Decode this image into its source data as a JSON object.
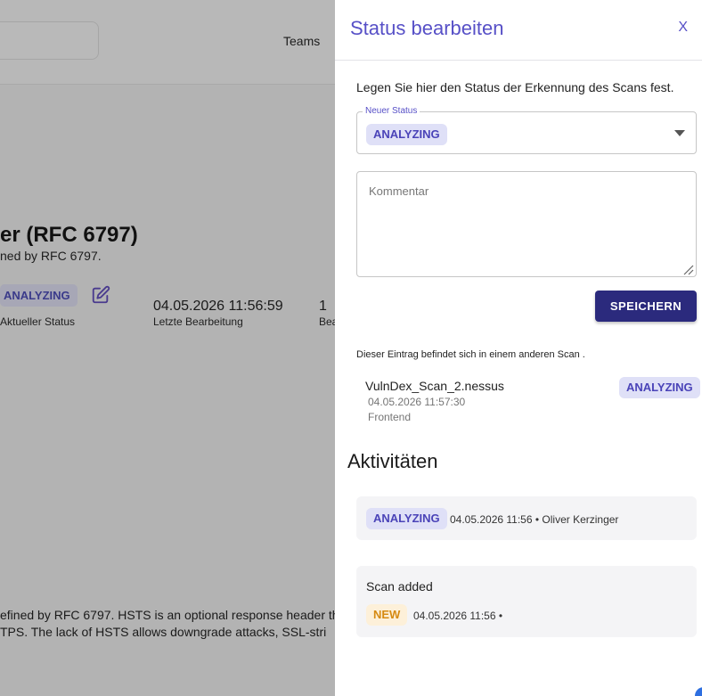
{
  "background": {
    "nav_teams": "Teams",
    "title": "er (RFC 6797)",
    "subtitle": "ned by RFC 6797.",
    "status_badge": "ANALYZING",
    "status_label": "Aktueller Status",
    "last_edit_value": "04.05.2026 11:56:59",
    "last_edit_label": "Letzte Bearbeitung",
    "count_value": "1",
    "count_label": "Bea",
    "description_line1": "efined by RFC 6797. HSTS is an optional response header th",
    "description_line2": "TPS. The lack of HSTS allows downgrade attacks, SSL-stri"
  },
  "drawer": {
    "title": "Status bearbeiten",
    "close_label": "X",
    "intro": "Legen Sie hier den Status der Erkennung des Scans fest.",
    "status_select": {
      "legend": "Neuer Status",
      "selected": "ANALYZING"
    },
    "comment_placeholder": "Kommentar",
    "save_label": "SPEICHERN",
    "note": "Dieser Eintrag befindet sich in einem anderen Scan .",
    "scan": {
      "name": "VulnDex_Scan_2.nessus",
      "date": "04.05.2026 11:57:30",
      "team": "Frontend",
      "status": "ANALYZING"
    },
    "activities_title": "Aktivitäten",
    "activities": [
      {
        "status": "ANALYZING",
        "meta": "04.05.2026 11:56 • Oliver Kerzinger"
      },
      {
        "text": "Scan added",
        "status": "NEW",
        "meta": "04.05.2026 11:56 •"
      }
    ]
  },
  "colors": {
    "accent": "#5750c7",
    "primary_button": "#2b2a7d",
    "chip_analyzing_bg": "#dfe0f7",
    "chip_new_bg": "#fdf0d9",
    "chip_new_fg": "#d68a12"
  }
}
